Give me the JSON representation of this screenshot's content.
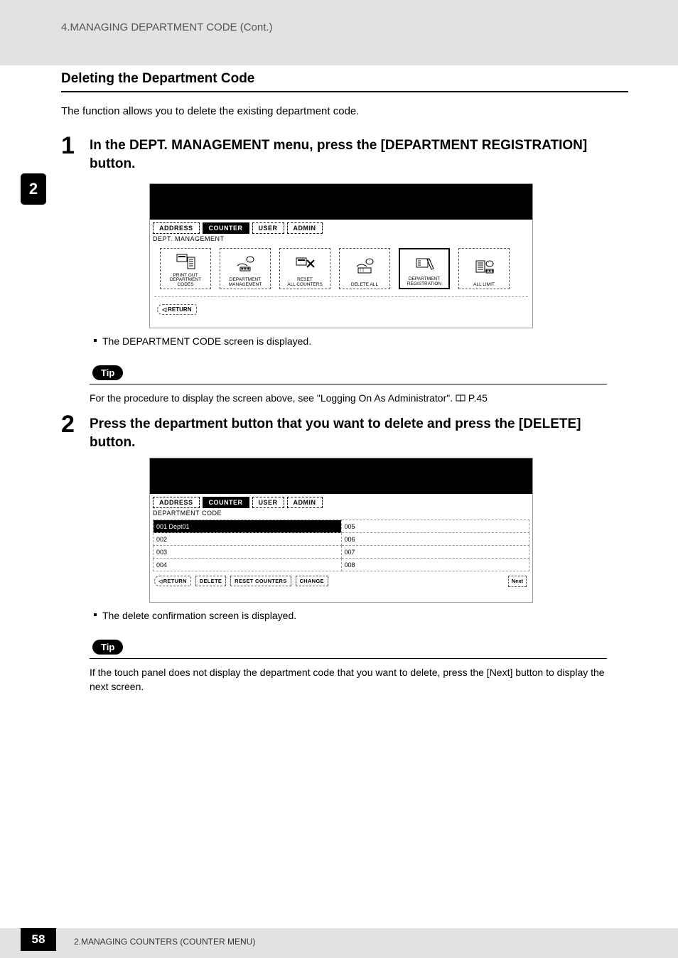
{
  "header": {
    "breadcrumb": "4.MANAGING DEPARTMENT CODE (Cont.)"
  },
  "side_tab": "2",
  "section": {
    "title": "Deleting the Department Code",
    "intro": "The function allows you to delete the existing department code."
  },
  "step1": {
    "num": "1",
    "title": "In the DEPT. MANAGEMENT menu, press the [DEPARTMENT REGISTRATION] button.",
    "bullet": "The DEPARTMENT CODE screen is displayed.",
    "tip_label": "Tip",
    "tip_text_prefix": "For the procedure to display the screen above, see \"Logging On As Administrator\".  ",
    "tip_page_ref": " P.45"
  },
  "step2": {
    "num": "2",
    "title": "Press the department button that you want to delete and press the [DELETE] button.",
    "bullet": "The delete confirmation screen is displayed.",
    "tip_label": "Tip",
    "tip_text": "If the touch panel does not display the department code that you want to delete, press the [Next] button to display the next screen."
  },
  "screenshot1": {
    "tabs": {
      "address": "ADDRESS",
      "counter": "COUNTER",
      "user": "USER",
      "admin": "ADMIN"
    },
    "label": "DEPT. MANAGEMENT",
    "icons": {
      "print": {
        "l1": "PRINT OUT",
        "l2": "DEPARTMENT CODES"
      },
      "mgmt": {
        "l1": "DEPARTMENT",
        "l2": "MANAGEMENT"
      },
      "reset": {
        "l1": "RESET",
        "l2": "ALL COUNTERS"
      },
      "delall": {
        "l1": "DELETE ALL",
        "l2": ""
      },
      "reg": {
        "l1": "DEPARTMENT",
        "l2": "REGISTRATION"
      },
      "limit": {
        "l1": "ALL LIMIT",
        "l2": ""
      }
    },
    "return": "RETURN"
  },
  "screenshot2": {
    "tabs": {
      "address": "ADDRESS",
      "counter": "COUNTER",
      "user": "USER",
      "admin": "ADMIN"
    },
    "label": "DEPARTMENT CODE",
    "rows": [
      {
        "a": "001 Dept01",
        "b": "005"
      },
      {
        "a": "002",
        "b": "006"
      },
      {
        "a": "003",
        "b": "007"
      },
      {
        "a": "004",
        "b": "008"
      }
    ],
    "buttons": {
      "return": "RETURN",
      "delete": "DELETE",
      "reset": "RESET COUNTERS",
      "change": "CHANGE",
      "next": "Next"
    }
  },
  "footer": {
    "page_num": "58",
    "text": "2.MANAGING COUNTERS (COUNTER MENU)"
  }
}
